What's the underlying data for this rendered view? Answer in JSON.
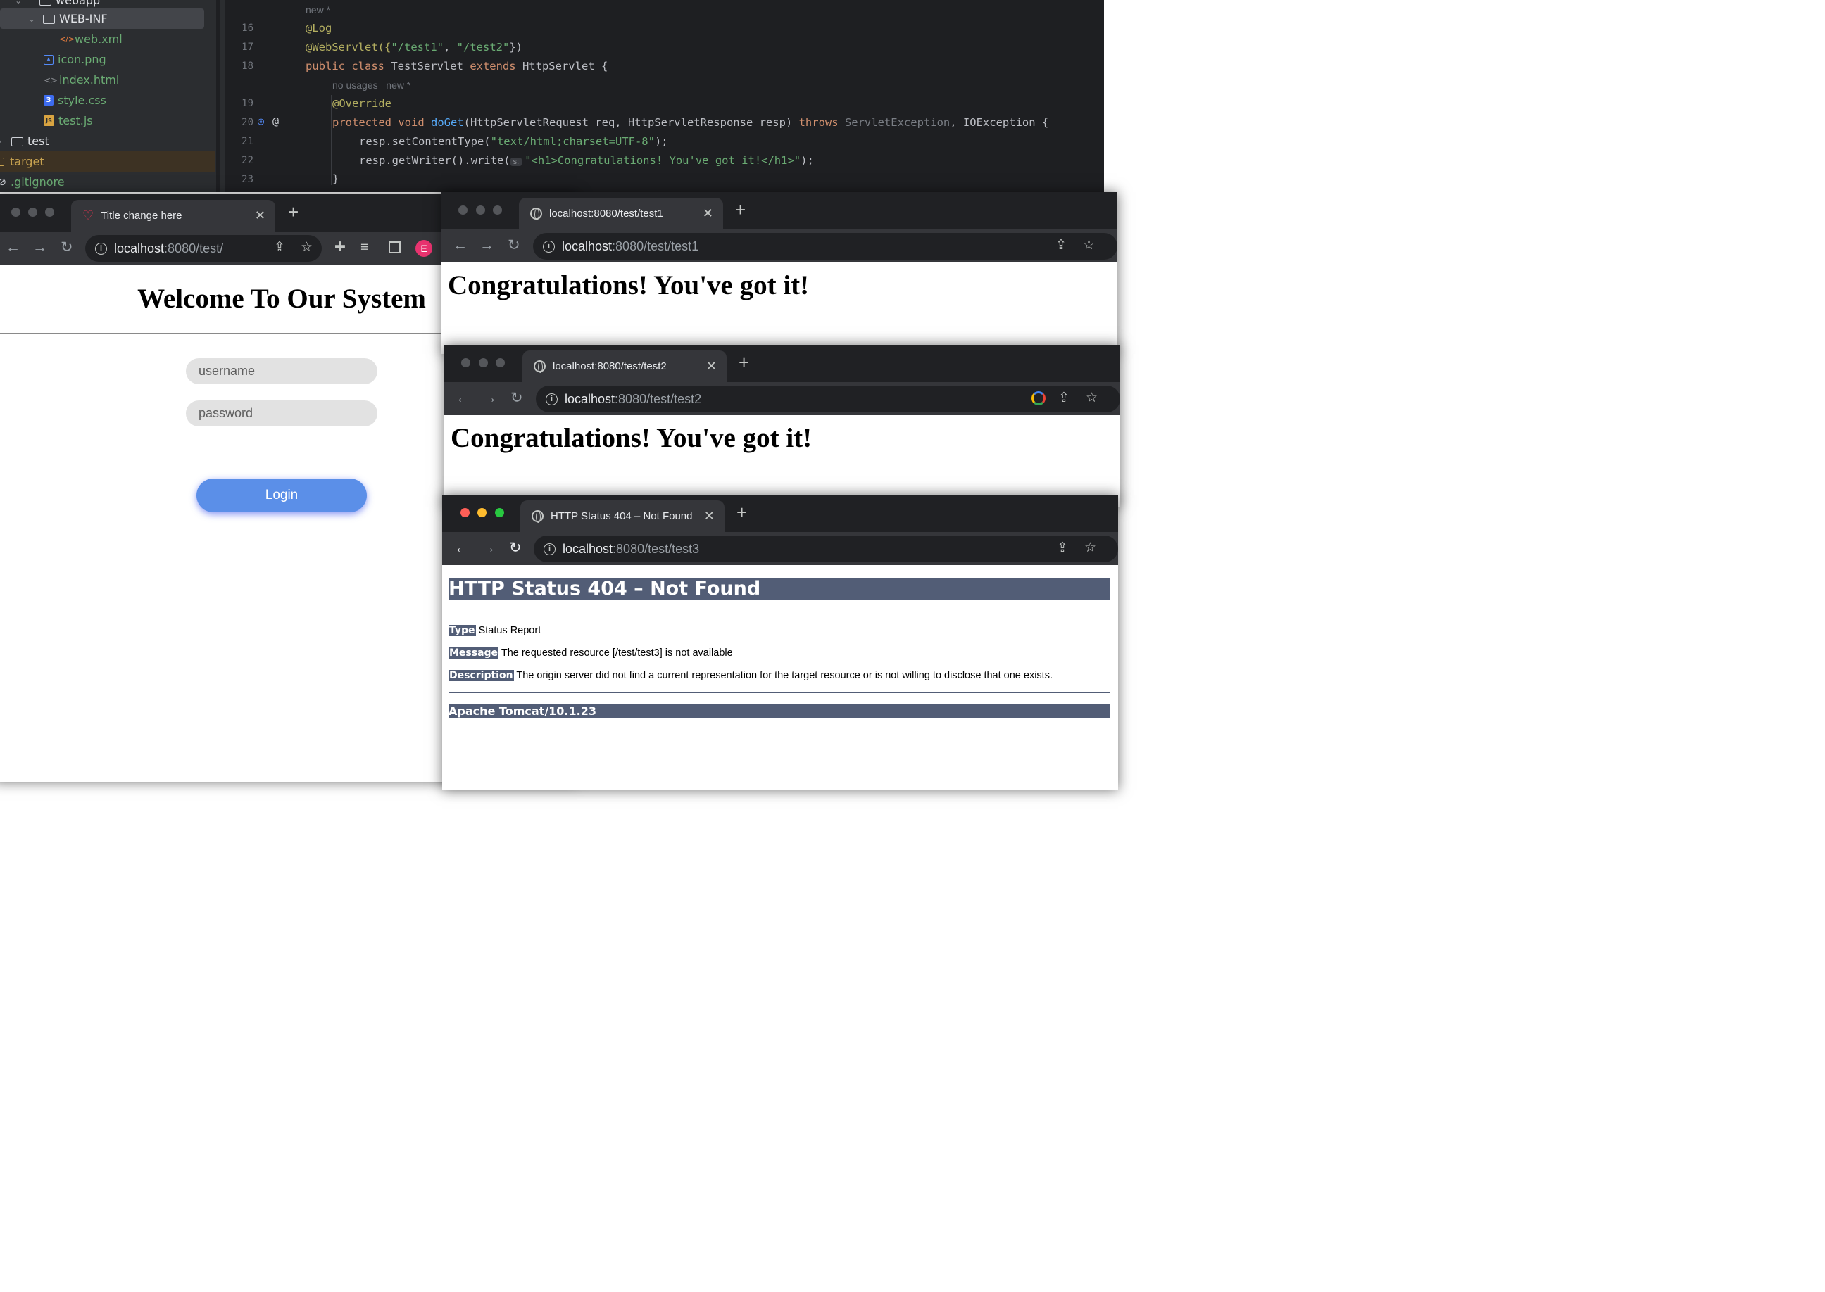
{
  "ide": {
    "tree": [
      {
        "label": "webapp"
      },
      {
        "label": "WEB-INF"
      },
      {
        "label": "web.xml"
      },
      {
        "label": "icon.png"
      },
      {
        "label": "index.html"
      },
      {
        "label": "style.css"
      },
      {
        "label": "test.js"
      },
      {
        "label": "test"
      },
      {
        "label": "target"
      },
      {
        "label": ".gitignore"
      }
    ],
    "hints": {
      "new": "new *",
      "no_usages": "no usages",
      "new2": "new *"
    },
    "line_numbers": [
      "16",
      "17",
      "18",
      "19",
      "20",
      "21",
      "22",
      "23"
    ],
    "code": {
      "l16": "@Log",
      "l17_a": "@WebServlet({",
      "l17_s1": "\"/test1\"",
      "l17_b": ", ",
      "l17_s2": "\"/test2\"",
      "l17_c": "})",
      "l18_kw": "public class",
      "l18_a": " TestServlet ",
      "l18_kw2": "extends",
      "l18_b": " HttpServlet {",
      "l19": "@Override",
      "l20_kw": "protected void",
      "l20_fn": "doGet",
      "l20_a": "(HttpServletRequest req, HttpServletResponse resp) ",
      "l20_kw2": "throws",
      "l20_dim": "ServletException",
      "l20_b": ", IOException {",
      "l21_a": "resp.setContentType(",
      "l21_s": "\"text/html;charset=UTF-8\"",
      "l21_b": ");",
      "l22_a": "resp.getWriter().write(",
      "l22_inlay": "s:",
      "l22_s": "\"<h1>Congratulations! You've got it!</h1>\"",
      "l22_b": ");",
      "l23": "}"
    }
  },
  "window1": {
    "tab_title": "Title change here",
    "url_host": "localhost",
    "url_rest": ":8080/test/",
    "profile_initial": "E",
    "heading": "Welcome To Our System",
    "username_placeholder": "username",
    "password_placeholder": "password",
    "login_label": "Login"
  },
  "window2": {
    "tab_title": "localhost:8080/test/test1",
    "url_host": "localhost",
    "url_rest": ":8080/test/test1",
    "heading": "Congratulations! You've got it!"
  },
  "window3": {
    "tab_title": "localhost:8080/test/test2",
    "url_host": "localhost",
    "url_rest": ":8080/test/test2",
    "heading": "Congratulations! You've got it!"
  },
  "window4": {
    "tab_title": "HTTP Status 404 – Not Found",
    "url_host": "localhost",
    "url_rest": ":8080/test/test3",
    "h1": "HTTP Status 404 – Not Found",
    "type_label": "Type",
    "type_value": "Status Report",
    "message_label": "Message",
    "message_value": "The requested resource [/test/test3] is not available",
    "description_label": "Description",
    "description_value": "The origin server did not find a current representation for the target resource or is not willing to disclose that one exists.",
    "footer": "Apache Tomcat/10.1.23"
  },
  "colors": {
    "traffic_red": "#ff5f57",
    "traffic_yellow": "#febc2e",
    "traffic_green": "#28c840",
    "login_button": "#5b8fe8",
    "tomcat_header": "#525d76"
  },
  "icons": [
    "folder-icon",
    "xml-file-icon",
    "image-file-icon",
    "html-file-icon",
    "css-file-icon",
    "js-file-icon",
    "heart-favicon",
    "globe-favicon",
    "info-icon",
    "share-icon",
    "star-icon",
    "extensions-icon",
    "reading-list-icon",
    "side-panel-icon",
    "google-icon"
  ]
}
